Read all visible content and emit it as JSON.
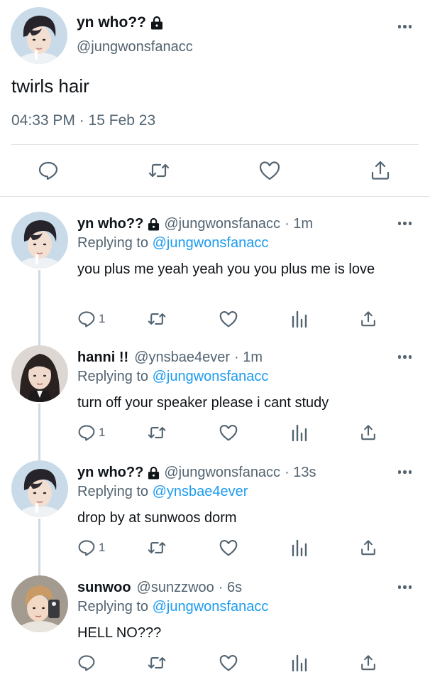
{
  "main_tweet": {
    "name": "yn who??",
    "handle": "@jungwonsfanacc",
    "text": "twirls hair",
    "timestamp": "04:33 PM · 15 Feb 23",
    "icons": [
      "lock-icon",
      "more-icon",
      "reply-icon",
      "retweet-icon",
      "like-icon",
      "share-icon"
    ]
  },
  "replies": [
    {
      "name": "yn who??",
      "locked": true,
      "handle": "@jungwonsfanacc",
      "time": "· 1m",
      "replying_prefix": "Replying to",
      "replying_to": "@jungwonsfanacc",
      "text": "you plus me yeah yeah you you plus me is love",
      "reply_count": "1"
    },
    {
      "name": "hanni !!",
      "locked": false,
      "handle": "@ynsbae4ever",
      "time": "· 1m",
      "replying_prefix": "Replying to",
      "replying_to": "@jungwonsfanacc",
      "text": "turn off your speaker please i cant study",
      "reply_count": "1"
    },
    {
      "name": "yn who??",
      "locked": true,
      "handle": "@jungwonsfanacc",
      "time": "· 13s",
      "replying_prefix": "Replying to",
      "replying_to": "@ynsbae4ever",
      "text": "drop by at sunwoos dorm",
      "reply_count": "1"
    },
    {
      "name": "sunwoo",
      "locked": false,
      "handle": "@sunzzwoo",
      "time": "· 6s",
      "replying_prefix": "Replying to",
      "replying_to": "@jungwonsfanacc",
      "text": "HELL NO???",
      "reply_count": ""
    }
  ],
  "colors": {
    "text": "#0f1419",
    "secondary": "#536471",
    "link": "#1d9bf0",
    "divider": "#dfe3e6",
    "thread_line": "#cfd9de"
  }
}
